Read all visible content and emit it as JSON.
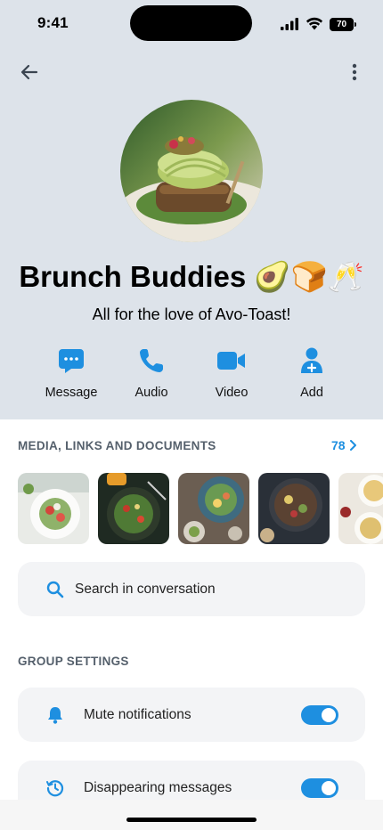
{
  "status_bar": {
    "time": "9:41",
    "battery": "70"
  },
  "group": {
    "name": "Brunch Buddies 🥑🍞🥂",
    "description": "All for the love of Avo-Toast!"
  },
  "actions": [
    {
      "label": "Message",
      "icon": "chat-bubble-icon"
    },
    {
      "label": "Audio",
      "icon": "phone-icon"
    },
    {
      "label": "Video",
      "icon": "video-camera-icon"
    },
    {
      "label": "Add",
      "icon": "add-user-icon"
    }
  ],
  "media": {
    "title": "MEDIA, LINKS AND DOCUMENTS",
    "count": "78"
  },
  "search": {
    "label": "Search in conversation"
  },
  "settings": {
    "title": "GROUP SETTINGS",
    "items": [
      {
        "label": "Mute notifications",
        "icon": "bell-icon",
        "enabled": true
      },
      {
        "label": "Disappearing messages",
        "icon": "timer-history-icon",
        "enabled": true
      }
    ]
  },
  "colors": {
    "accent": "#1e8fe0",
    "header_bg": "#dde3ea",
    "row_bg": "#f3f4f6"
  }
}
